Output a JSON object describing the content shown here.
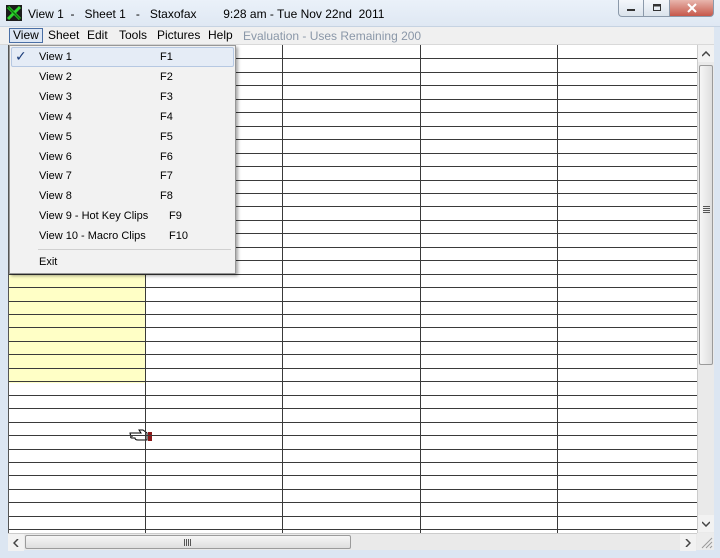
{
  "window": {
    "title": "View 1  -   Sheet 1   -   Staxofax        9:28 am - Tue Nov 22nd  2011"
  },
  "menubar": {
    "items": [
      {
        "label": "View",
        "active": true
      },
      {
        "label": "Sheet"
      },
      {
        "label": "Edit"
      },
      {
        "label": "Tools"
      },
      {
        "label": "Pictures"
      },
      {
        "label": "Help"
      }
    ],
    "evaluation": "Evaluation - Uses Remaining 200"
  },
  "view_menu": {
    "items": [
      {
        "label": "View 1",
        "key": "F1",
        "checked": true
      },
      {
        "label": "View 2",
        "key": "F2"
      },
      {
        "label": "View 3",
        "key": "F3"
      },
      {
        "label": "View 4",
        "key": "F4"
      },
      {
        "label": "View 5",
        "key": "F5"
      },
      {
        "label": "View 6",
        "key": "F6"
      },
      {
        "label": "View 7",
        "key": "F7"
      },
      {
        "label": "View 8",
        "key": "F8"
      },
      {
        "label": "View 9 - Hot Key Clips",
        "key": "F9"
      },
      {
        "label": "View 10 - Macro Clips",
        "key": "F10"
      }
    ],
    "exit": "Exit"
  },
  "icons": {
    "app": "staxofax-app-icon",
    "minimize": "minimize-icon",
    "maximize": "maximize-icon",
    "close": "close-icon",
    "check": "checkmark-icon",
    "pointer": "pointing-hand-icon"
  },
  "colors": {
    "selection": "#ffffc6",
    "titlebar": "#dfe8f3",
    "menu_highlight": "#e5ecf6",
    "close_button": "#c6574a"
  }
}
